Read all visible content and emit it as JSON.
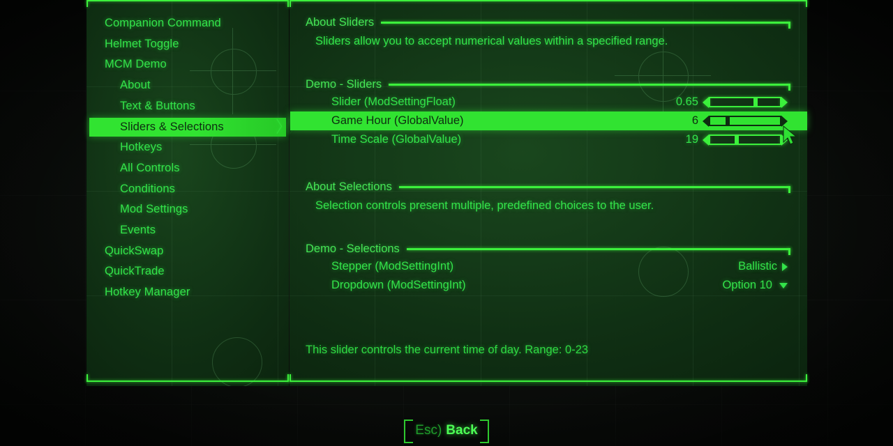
{
  "theme": {
    "accent": "#3cf03c",
    "text": "#33e34a",
    "highlight_bg": "#31e331",
    "highlight_text": "#0d2d10",
    "panel_bg": "#10321a",
    "screen_bg": "#0a0c0a"
  },
  "sidebar": {
    "items": [
      {
        "label": "Companion Command",
        "level": 0,
        "selected": false
      },
      {
        "label": "Helmet Toggle",
        "level": 0,
        "selected": false
      },
      {
        "label": "MCM Demo",
        "level": 0,
        "selected": false
      },
      {
        "label": "About",
        "level": 1,
        "selected": false
      },
      {
        "label": "Text & Buttons",
        "level": 1,
        "selected": false
      },
      {
        "label": "Sliders & Selections",
        "level": 1,
        "selected": true
      },
      {
        "label": "Hotkeys",
        "level": 1,
        "selected": false
      },
      {
        "label": "All Controls",
        "level": 1,
        "selected": false
      },
      {
        "label": "Conditions",
        "level": 1,
        "selected": false
      },
      {
        "label": "Mod Settings",
        "level": 1,
        "selected": false
      },
      {
        "label": "Events",
        "level": 1,
        "selected": false
      },
      {
        "label": "QuickSwap",
        "level": 0,
        "selected": false
      },
      {
        "label": "QuickTrade",
        "level": 0,
        "selected": false
      },
      {
        "label": "Hotkey Manager",
        "level": 0,
        "selected": false
      }
    ],
    "selected_chevron": "〉〉"
  },
  "content": {
    "groups": [
      {
        "title": "About Sliders",
        "description": "Sliders allow you to accept numerical values within a specified range.",
        "rows": []
      },
      {
        "title": "Demo - Sliders",
        "description": null,
        "rows": [
          {
            "label": "Slider (ModSettingFloat)",
            "value": "0.65",
            "control": "slider",
            "fill_percent": 65,
            "highlighted": false
          },
          {
            "label": "Game Hour (GlobalValue)",
            "value": "6",
            "control": "slider",
            "fill_percent": 25,
            "highlighted": true
          },
          {
            "label": "Time Scale (GlobalValue)",
            "value": "19",
            "control": "slider",
            "fill_percent": 38,
            "highlighted": false
          }
        ]
      },
      {
        "title": "About Selections",
        "description": "Selection controls present multiple, predefined choices to the user.",
        "rows": []
      },
      {
        "title": "Demo - Selections",
        "description": null,
        "rows": [
          {
            "label": "Stepper (ModSettingInt)",
            "value": "Ballistic",
            "control": "stepper",
            "highlighted": false
          },
          {
            "label": "Dropdown (ModSettingInt)",
            "value": "Option 10",
            "control": "dropdown",
            "highlighted": false
          }
        ]
      }
    ],
    "help_text": "This slider controls the current time of day. Range: 0-23"
  },
  "footer": {
    "esc_key": "Esc)",
    "back_label": "Back"
  }
}
